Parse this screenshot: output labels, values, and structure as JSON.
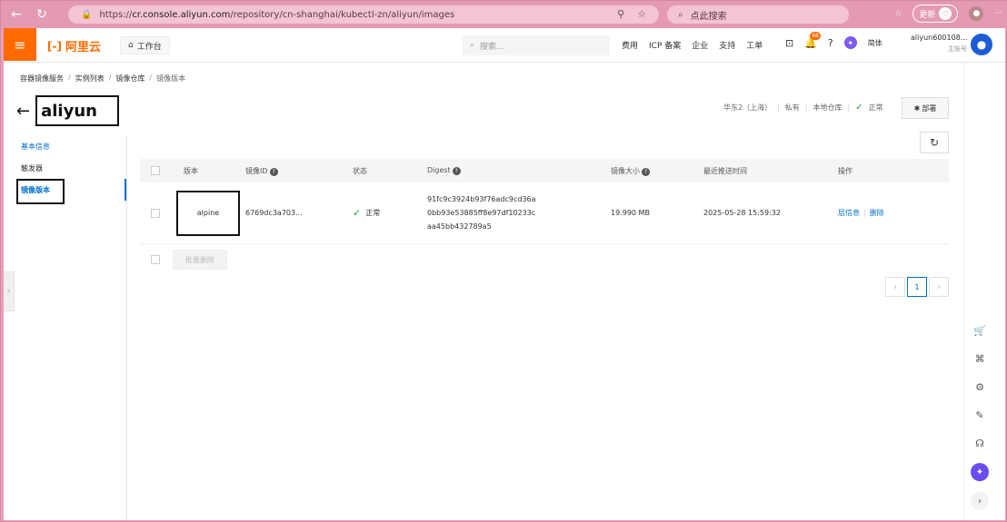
{
  "browser": {
    "url_prefix": "https://",
    "url_host": "cr.console.aliyun.com",
    "url_path": "/repository/cn-shanghai/kubectl-zn/aliyun/images",
    "search_placeholder": "点此搜索",
    "update_label": "更新"
  },
  "topbar": {
    "logo": "阿里云",
    "workbench": "工作台",
    "search_placeholder": "搜索...",
    "links": [
      "费用",
      "ICP 备案",
      "企业",
      "支持",
      "工单"
    ],
    "bell_badge": "68",
    "lang": "简体",
    "account_name": "aliyun600108...",
    "account_type": "主账号"
  },
  "breadcrumb": [
    "容器镜像服务",
    "实例列表",
    "镜像仓库",
    "镜像版本"
  ],
  "page": {
    "title": "aliyun",
    "region": "华东2（上海）",
    "visibility": "私有",
    "repo_type": "本地仓库",
    "status": "正常",
    "deploy_label": "部署"
  },
  "sidenav": [
    "基本信息",
    "触发器",
    "镜像版本"
  ],
  "table": {
    "headers": [
      "版本",
      "镜像ID",
      "状态",
      "Digest",
      "镜像大小",
      "最近推送时间",
      "操作"
    ],
    "rows": [
      {
        "version": "alpine",
        "image_id": "6769dc3a703...",
        "status": "正常",
        "digest": [
          "91fc9c3924b93f76adc9cd36a",
          "0bb93e53885ff8e97df10233c",
          "aa45bb432789a5"
        ],
        "size": "19.990 MB",
        "pushed": "2025-05-28 15:59:32",
        "op_info": "层信息",
        "op_delete": "删除"
      }
    ]
  },
  "batch_delete": "批量删除",
  "pager": {
    "current": "1"
  }
}
